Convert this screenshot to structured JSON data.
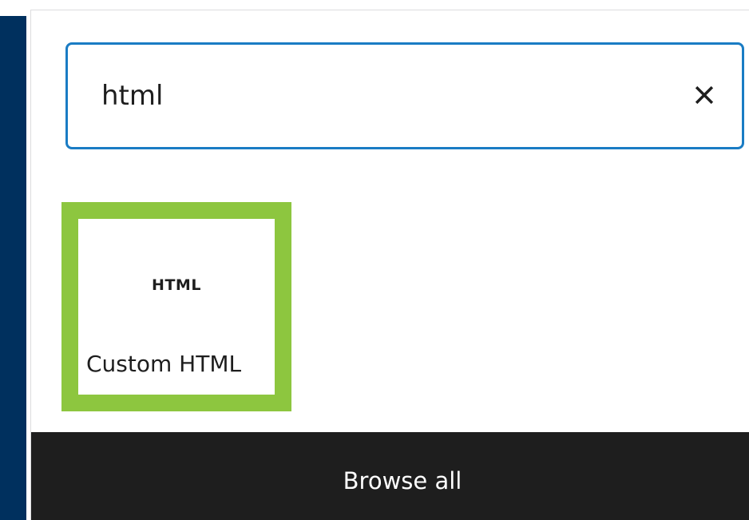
{
  "search": {
    "value": "html",
    "clear_icon": "close-icon",
    "focus_color": "#1a7cc4"
  },
  "results": [
    {
      "icon_text": "HTML",
      "label": "Custom HTML",
      "highlight_color": "#8dc63f"
    }
  ],
  "footer": {
    "browse_all_label": "Browse all",
    "background": "#1e1e1e"
  },
  "sidebar": {
    "color": "#00305e"
  }
}
